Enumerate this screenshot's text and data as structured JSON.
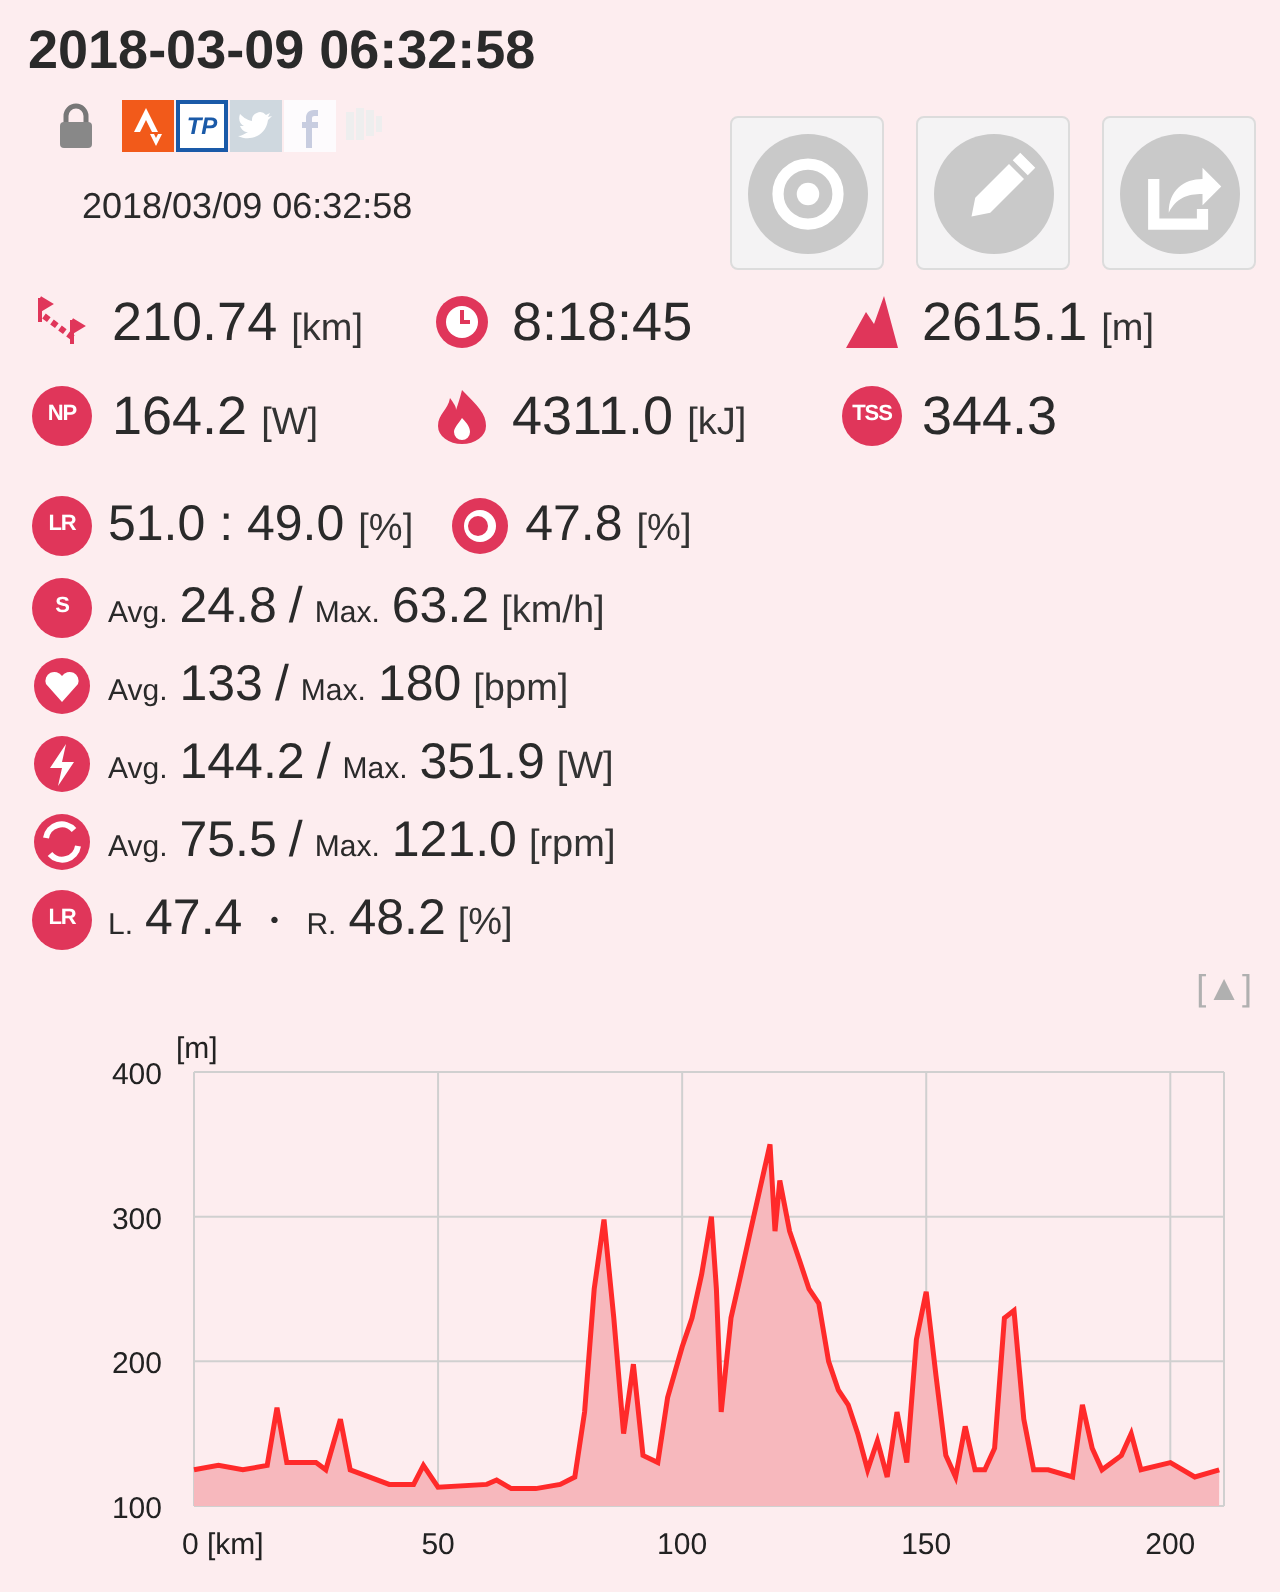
{
  "title": "2018-03-09 06:32:58",
  "services": [
    {
      "kind": "lock"
    },
    {
      "kind": "strava"
    },
    {
      "kind": "tp",
      "text": "TP"
    },
    {
      "kind": "twitter"
    },
    {
      "kind": "facebook"
    },
    {
      "kind": "other"
    }
  ],
  "date": "2018/03/09 06:32:58",
  "actions": [
    {
      "kind": "lens"
    },
    {
      "kind": "edit"
    },
    {
      "kind": "share"
    }
  ],
  "summary": [
    {
      "kind": "distance",
      "value": "210.74",
      "unit": "[km]"
    },
    {
      "kind": "clock",
      "value": "8:18:45"
    },
    {
      "kind": "mountain",
      "value": "2615.1",
      "unit": "[m]"
    },
    {
      "kind": "np",
      "icon_text": "NP",
      "value": "164.2",
      "unit": "[W]"
    },
    {
      "kind": "fire",
      "value": "4311.0",
      "unit": "[kJ]"
    },
    {
      "kind": "tss",
      "icon_text": "TSS",
      "value": "344.3"
    }
  ],
  "balance": [
    {
      "kind": "lr",
      "icon_text": "LR",
      "value": "51.0 : 49.0",
      "unit": "[%]"
    },
    {
      "kind": "smooth",
      "value": "47.8",
      "unit": "[%]"
    }
  ],
  "averages": [
    {
      "kind": "speed",
      "icon_text": "S",
      "avg_label": "Avg.",
      "avg": "24.8",
      "sep": "/",
      "max_label": "Max.",
      "max": "63.2",
      "unit": "[km/h]"
    },
    {
      "kind": "heart",
      "avg_label": "Avg.",
      "avg": "133",
      "sep": "/",
      "max_label": "Max.",
      "max": "180",
      "unit": "[bpm]"
    },
    {
      "kind": "power",
      "avg_label": "Avg.",
      "avg": "144.2",
      "sep": "/",
      "max_label": "Max.",
      "max": "351.9",
      "unit": "[W]"
    },
    {
      "kind": "cadence",
      "avg_label": "Avg.",
      "avg": "75.5",
      "sep": "/",
      "max_label": "Max.",
      "max": "121.0",
      "unit": "[rpm]"
    }
  ],
  "pedal": {
    "icon_text": "LR",
    "l_label": "L.",
    "l": "47.4",
    "sep": "・",
    "r_label": "R.",
    "r": "48.2",
    "unit": "[%]"
  },
  "collapse_toggle": "[▲]",
  "elevation": {
    "chart_data": {
      "type": "area",
      "grid": true,
      "ylabel": "[m]",
      "xlim": [
        0,
        211
      ],
      "ylim": [
        100,
        400
      ],
      "xticks": [
        {
          "value": 0,
          "label": "0 [km]"
        },
        50,
        100,
        150,
        200
      ],
      "yticks": [
        100,
        200,
        300,
        400
      ],
      "x": [
        0,
        5,
        10,
        15,
        17,
        19,
        25,
        27,
        30,
        32,
        40,
        45,
        47,
        50,
        60,
        62,
        65,
        70,
        75,
        78,
        80,
        82,
        84,
        86,
        88,
        90,
        92,
        95,
        97,
        100,
        102,
        104,
        106,
        107,
        108,
        110,
        112,
        114,
        116,
        118,
        119,
        120,
        122,
        124,
        126,
        128,
        130,
        132,
        134,
        136,
        138,
        140,
        142,
        144,
        146,
        148,
        150,
        152,
        154,
        156,
        158,
        160,
        162,
        164,
        166,
        168,
        170,
        172,
        175,
        180,
        182,
        184,
        186,
        190,
        192,
        194,
        200,
        205,
        210
      ],
      "series": [
        {
          "color": "#ff2a2a",
          "values": [
            125,
            128,
            125,
            128,
            168,
            130,
            130,
            125,
            160,
            125,
            115,
            115,
            128,
            113,
            115,
            118,
            112,
            112,
            115,
            120,
            165,
            250,
            298,
            230,
            150,
            198,
            135,
            130,
            175,
            210,
            230,
            260,
            300,
            250,
            165,
            230,
            260,
            290,
            320,
            350,
            290,
            325,
            290,
            270,
            250,
            240,
            200,
            180,
            170,
            150,
            125,
            145,
            120,
            165,
            130,
            215,
            248,
            190,
            135,
            120,
            155,
            125,
            125,
            140,
            230,
            235,
            160,
            125,
            125,
            120,
            170,
            140,
            125,
            135,
            150,
            125,
            130,
            120,
            125
          ]
        }
      ]
    }
  }
}
